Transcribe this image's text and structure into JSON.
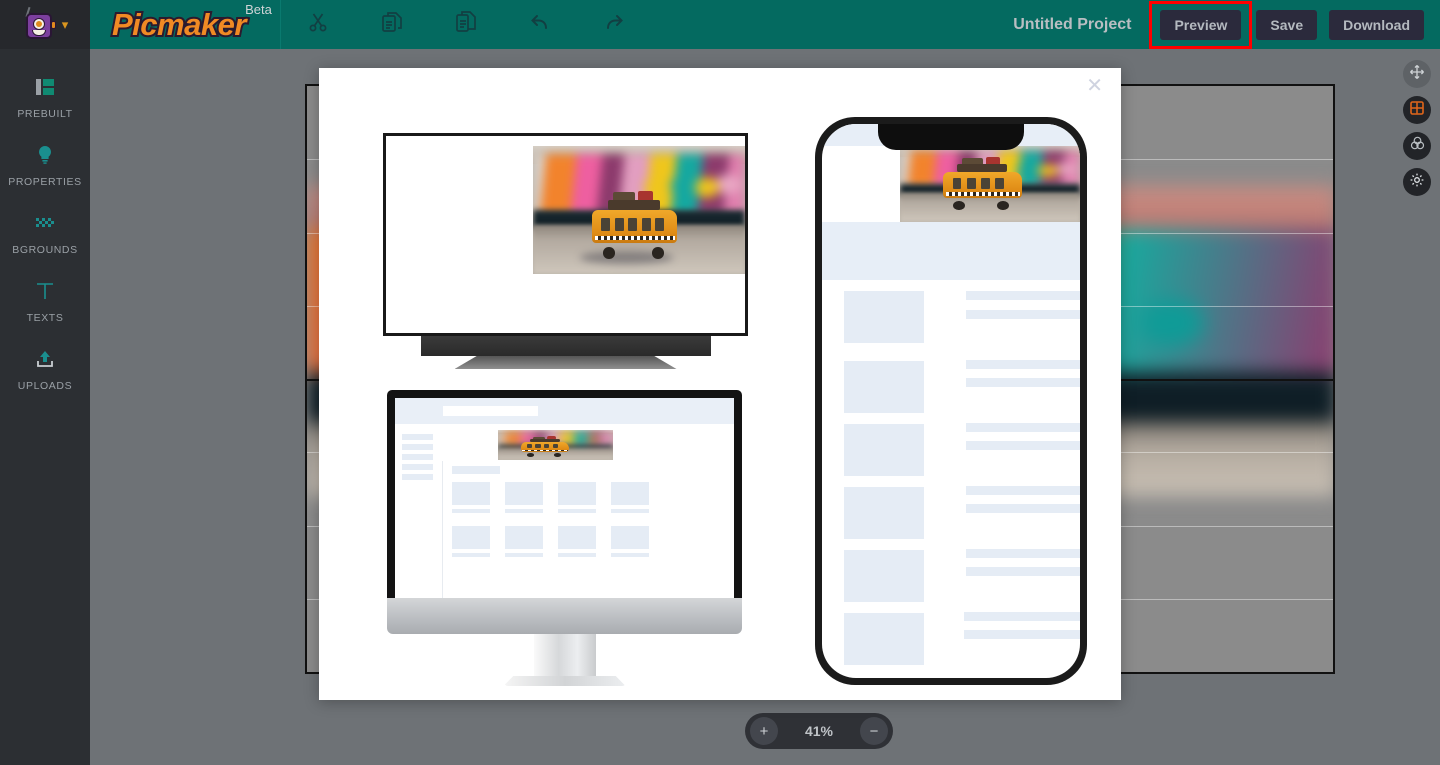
{
  "app": {
    "brand": "Picmaker",
    "badge": "Beta",
    "avatar_icon": "robot-avatar-icon",
    "account_chevron_icon": "chevron-down-icon"
  },
  "header": {
    "project_title": "Untitled Project",
    "tools": [
      {
        "name": "cut",
        "icon": "scissors-icon"
      },
      {
        "name": "copy",
        "icon": "copy-icon"
      },
      {
        "name": "paste",
        "icon": "paste-icon"
      },
      {
        "name": "undo",
        "icon": "undo-arrow-icon"
      },
      {
        "name": "redo",
        "icon": "redo-arrow-icon"
      }
    ],
    "actions": [
      {
        "name": "preview",
        "label": "Preview",
        "highlighted": true
      },
      {
        "name": "save",
        "label": "Save",
        "highlighted": false
      },
      {
        "name": "download",
        "label": "Download",
        "highlighted": false
      }
    ],
    "highlight_color": "#ff0000",
    "bar_color": "#046a60"
  },
  "sidebar": {
    "items": [
      {
        "label": "PREBUILT",
        "icon": "layout-grid-icon"
      },
      {
        "label": "PROPERTIES",
        "icon": "lightbulb-icon"
      },
      {
        "label": "BGROUNDS",
        "icon": "checkerboard-icon"
      },
      {
        "label": "TEXTS",
        "icon": "text-t-icon"
      },
      {
        "label": "UPLOADS",
        "icon": "upload-arrow-icon"
      }
    ],
    "accent": "#1a8f8f"
  },
  "right_rail": {
    "items": [
      {
        "name": "pan-move",
        "icon": "move-arrows-icon",
        "active": false
      },
      {
        "name": "grid-toggle",
        "icon": "grid-squares-icon",
        "active": true
      },
      {
        "name": "color-blend",
        "icon": "venn-circles-icon",
        "active": false
      },
      {
        "name": "canvas-settings",
        "icon": "gear-icon",
        "active": false
      }
    ],
    "active_color": "#e2661a"
  },
  "zoom_control": {
    "value": "41%",
    "increase_label": "+",
    "decrease_label": "−"
  },
  "canvas": {
    "background_image": "blurred-graffiti-wall-photo",
    "grid_visible": true,
    "grid_columns": 2,
    "grid_rows": 8
  },
  "preview_modal": {
    "close_icon": "close-x-icon",
    "mockups": [
      {
        "name": "desktop-monitor-preview",
        "device": "monitor",
        "content": "toy-vw-bus-photo"
      },
      {
        "name": "imac-wireframe-preview",
        "device": "imac",
        "content": "wireframe-skeleton-layout",
        "card_rows": 2,
        "cards_per_row": 4,
        "sidebar_lines": 5
      },
      {
        "name": "mobile-phone-preview",
        "device": "phone",
        "content": "wireframe-skeleton-list",
        "list_rows": 6,
        "lines_per_row": 2
      }
    ]
  }
}
